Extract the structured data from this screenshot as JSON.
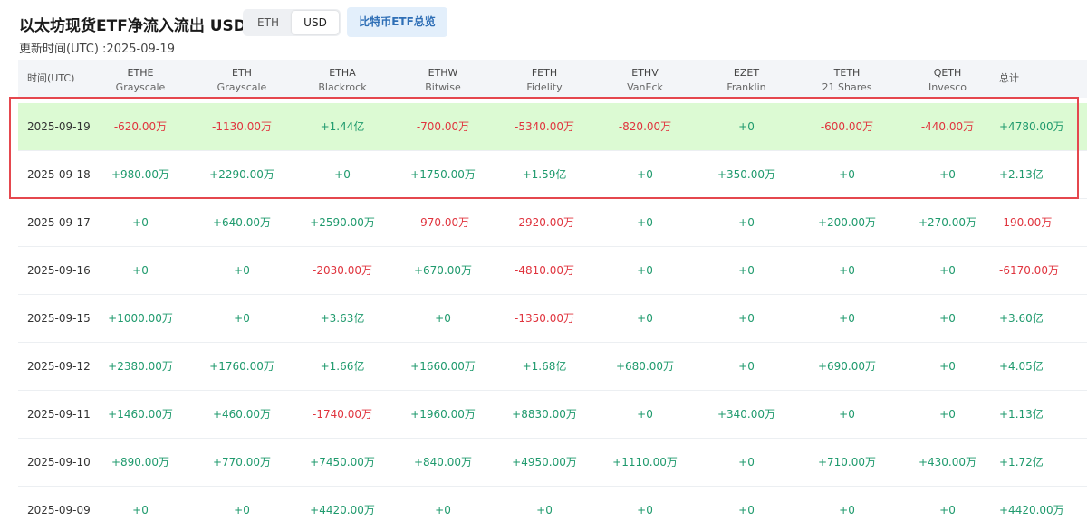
{
  "page": {
    "title": "以太坊现货ETF净流入流出 USD",
    "updated": "更新时间(UTC) :2025-09-19"
  },
  "unit_toggle": {
    "options": [
      "ETH",
      "USD"
    ],
    "selected": "USD"
  },
  "btc_overview_button": "比特币ETF总览",
  "table": {
    "headers": [
      {
        "symbol": "时间(UTC)",
        "issuer": ""
      },
      {
        "symbol": "ETHE",
        "issuer": "Grayscale"
      },
      {
        "symbol": "ETH",
        "issuer": "Grayscale"
      },
      {
        "symbol": "ETHA",
        "issuer": "Blackrock"
      },
      {
        "symbol": "ETHW",
        "issuer": "Bitwise"
      },
      {
        "symbol": "FETH",
        "issuer": "Fidelity"
      },
      {
        "symbol": "ETHV",
        "issuer": "VanEck"
      },
      {
        "symbol": "EZET",
        "issuer": "Franklin"
      },
      {
        "symbol": "TETH",
        "issuer": "21 Shares"
      },
      {
        "symbol": "QETH",
        "issuer": "Invesco"
      },
      {
        "symbol": "总计",
        "issuer": ""
      }
    ],
    "rows": [
      {
        "date": "2025-09-19",
        "values": [
          "-620.00万",
          "-1130.00万",
          "+1.44亿",
          "-700.00万",
          "-5340.00万",
          "-820.00万",
          "+0",
          "-600.00万",
          "-440.00万",
          "+4780.00万"
        ],
        "highlight": true
      },
      {
        "date": "2025-09-18",
        "values": [
          "+980.00万",
          "+2290.00万",
          "+0",
          "+1750.00万",
          "+1.59亿",
          "+0",
          "+350.00万",
          "+0",
          "+0",
          "+2.13亿"
        ],
        "highlight": false
      },
      {
        "date": "2025-09-17",
        "values": [
          "+0",
          "+640.00万",
          "+2590.00万",
          "-970.00万",
          "-2920.00万",
          "+0",
          "+0",
          "+200.00万",
          "+270.00万",
          "-190.00万"
        ],
        "highlight": false
      },
      {
        "date": "2025-09-16",
        "values": [
          "+0",
          "+0",
          "-2030.00万",
          "+670.00万",
          "-4810.00万",
          "+0",
          "+0",
          "+0",
          "+0",
          "-6170.00万"
        ],
        "highlight": false
      },
      {
        "date": "2025-09-15",
        "values": [
          "+1000.00万",
          "+0",
          "+3.63亿",
          "+0",
          "-1350.00万",
          "+0",
          "+0",
          "+0",
          "+0",
          "+3.60亿"
        ],
        "highlight": false
      },
      {
        "date": "2025-09-12",
        "values": [
          "+2380.00万",
          "+1760.00万",
          "+1.66亿",
          "+1660.00万",
          "+1.68亿",
          "+680.00万",
          "+0",
          "+690.00万",
          "+0",
          "+4.05亿"
        ],
        "highlight": false
      },
      {
        "date": "2025-09-11",
        "values": [
          "+1460.00万",
          "+460.00万",
          "-1740.00万",
          "+1960.00万",
          "+8830.00万",
          "+0",
          "+340.00万",
          "+0",
          "+0",
          "+1.13亿"
        ],
        "highlight": false
      },
      {
        "date": "2025-09-10",
        "values": [
          "+890.00万",
          "+770.00万",
          "+7450.00万",
          "+840.00万",
          "+4950.00万",
          "+1110.00万",
          "+0",
          "+710.00万",
          "+430.00万",
          "+1.72亿"
        ],
        "highlight": false
      },
      {
        "date": "2025-09-09",
        "values": [
          "+0",
          "+0",
          "+4420.00万",
          "+0",
          "+0",
          "+0",
          "+0",
          "+0",
          "+0",
          "+4420.00万"
        ],
        "highlight": false
      }
    ],
    "colors": {
      "positive": "#1f9a6d",
      "negative": "#e0343e",
      "highlight_row": "#dcfad3",
      "annotation_box": "#e5474e"
    }
  }
}
